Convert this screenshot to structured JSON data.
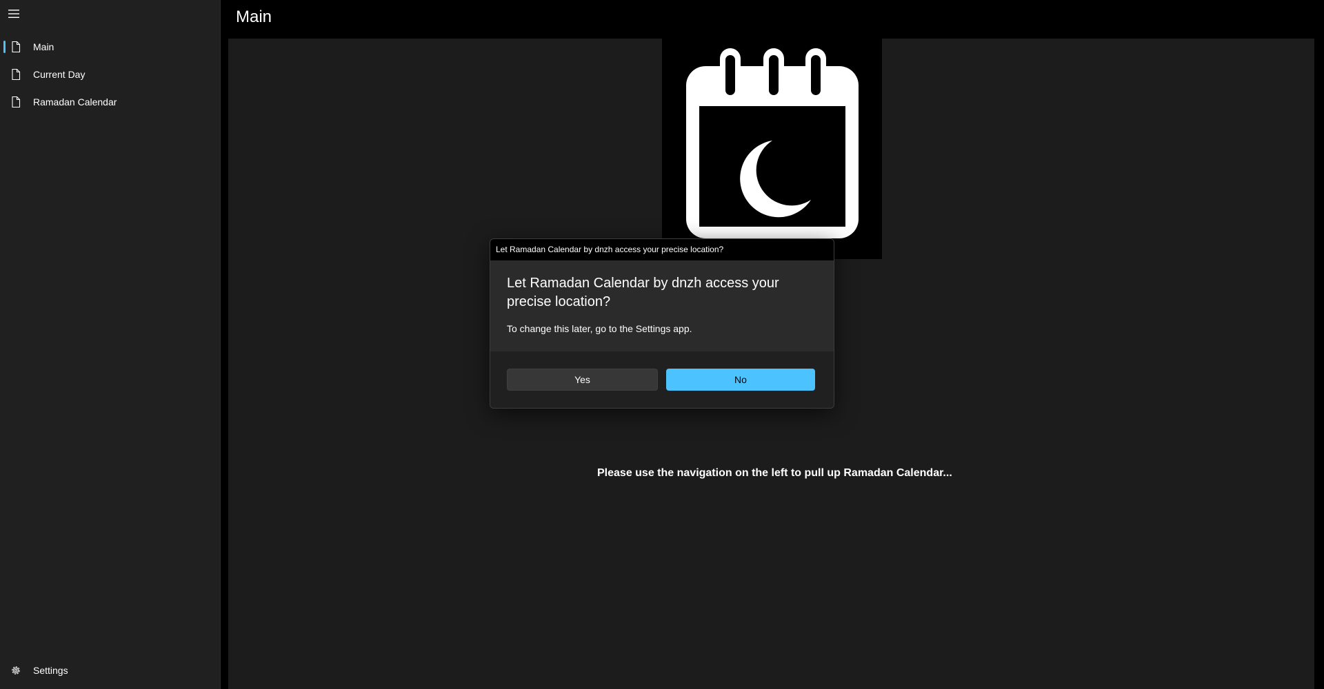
{
  "header": {
    "title": "Main"
  },
  "sidebar": {
    "menu_icon": "hamburger-menu-icon",
    "items": [
      {
        "label": "Main",
        "icon": "document-icon",
        "selected": true
      },
      {
        "label": "Current Day",
        "icon": "document-icon",
        "selected": false
      },
      {
        "label": "Ramadan Calendar",
        "icon": "document-icon",
        "selected": false
      }
    ],
    "settings": {
      "label": "Settings",
      "icon": "gear-icon"
    }
  },
  "main": {
    "logo_icon": "ramadan-calendar-crescent-icon",
    "message": "Please use the navigation on the left to pull up Ramadan Calendar..."
  },
  "dialog": {
    "titlebar": "Let Ramadan Calendar by dnzh access your precise location?",
    "heading": "Let Ramadan Calendar by dnzh access your precise location?",
    "subtext": "To change this later, go to the Settings app.",
    "yes_label": "Yes",
    "no_label": "No"
  },
  "colors": {
    "accent": "#4cc2ff",
    "sidebar_bg": "#202020",
    "content_bg": "#1c1c1c",
    "dialog_bg": "#2b2b2b"
  }
}
